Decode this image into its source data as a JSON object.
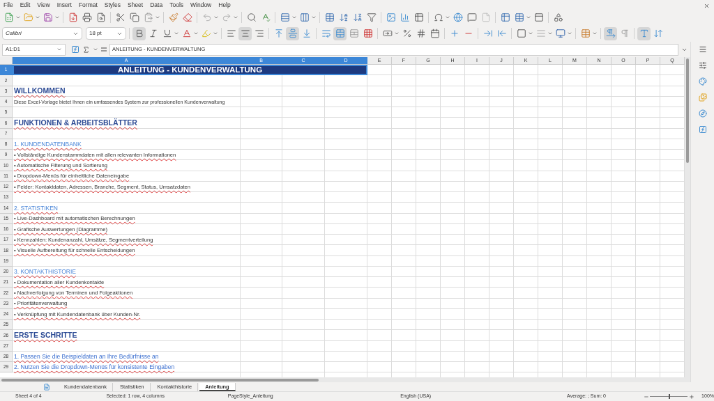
{
  "menu": [
    "File",
    "Edit",
    "View",
    "Insert",
    "Format",
    "Styles",
    "Sheet",
    "Data",
    "Tools",
    "Window",
    "Help"
  ],
  "format_toolbar": {
    "font_name": "Calibri",
    "font_size": "18 pt",
    "bold": true,
    "italic": false,
    "underline": false,
    "align_left": false,
    "align_center": true,
    "align_right": false,
    "valign_top": false,
    "valign_center": true,
    "valign_bottom": false,
    "merge_center": true,
    "ltr": true,
    "horizontal_text": true
  },
  "formula_bar": {
    "name_box": "A1:D1",
    "content": "ANLEITUNG - KUNDENVERWALTUNG"
  },
  "columns": [
    {
      "label": "A",
      "selected": true
    },
    {
      "label": "B",
      "selected": true
    },
    {
      "label": "C",
      "selected": true
    },
    {
      "label": "D",
      "selected": true
    },
    {
      "label": "E",
      "selected": false
    },
    {
      "label": "F",
      "selected": false
    },
    {
      "label": "G",
      "selected": false
    },
    {
      "label": "H",
      "selected": false
    },
    {
      "label": "I",
      "selected": false
    },
    {
      "label": "J",
      "selected": false
    },
    {
      "label": "K",
      "selected": false
    },
    {
      "label": "L",
      "selected": false
    },
    {
      "label": "M",
      "selected": false
    },
    {
      "label": "N",
      "selected": false
    },
    {
      "label": "O",
      "selected": false
    },
    {
      "label": "P",
      "selected": false
    },
    {
      "label": "Q",
      "selected": false
    }
  ],
  "rows": [
    {
      "number": "1",
      "selected": true,
      "kind": "title",
      "text": "ANLEITUNG - KUNDENVERWALTUNG"
    },
    {
      "number": "2",
      "selected": false,
      "kind": "empty"
    },
    {
      "number": "3",
      "selected": false,
      "kind": "heading",
      "text": "WILLKOMMEN"
    },
    {
      "number": "4",
      "selected": false,
      "kind": "wrapped",
      "text": "Diese Excel-Vorlage bietet Ihnen ein umfassendes System zur professionellen Kundenverwaltung"
    },
    {
      "number": "5",
      "selected": false,
      "kind": "empty"
    },
    {
      "number": "6",
      "selected": false,
      "kind": "heading",
      "text": "FUNKTIONEN & ARBEITSBLÄTTER"
    },
    {
      "number": "7",
      "selected": false,
      "kind": "empty"
    },
    {
      "number": "8",
      "selected": false,
      "kind": "subheading",
      "text": "1. KUNDENDATENBANK"
    },
    {
      "number": "9",
      "selected": false,
      "kind": "bullet",
      "text": "• Vollständige Kundenstammdaten mit allen relevanten Informationen"
    },
    {
      "number": "10",
      "selected": false,
      "kind": "bullet",
      "text": "• Automatische Filterung und Sortierung"
    },
    {
      "number": "11",
      "selected": false,
      "kind": "bullet",
      "text": "• Dropdown-Menüs für einheitliche Dateneingabe"
    },
    {
      "number": "12",
      "selected": false,
      "kind": "bullet",
      "text": "• Felder: Kontaktdaten, Adressen, Branche, Segment, Status, Umsatzdaten"
    },
    {
      "number": "13",
      "selected": false,
      "kind": "empty"
    },
    {
      "number": "14",
      "selected": false,
      "kind": "subheading",
      "text": "2. STATISTIKEN"
    },
    {
      "number": "15",
      "selected": false,
      "kind": "bullet",
      "text": "• Live-Dashboard mit automatischen Berechnungen"
    },
    {
      "number": "16",
      "selected": false,
      "kind": "bullet",
      "text": "• Grafische Auswertungen (Diagramme)"
    },
    {
      "number": "17",
      "selected": false,
      "kind": "bullet",
      "text": "• Kennzahlen: Kundenanzahl, Umsätze, Segmentverteilung"
    },
    {
      "number": "18",
      "selected": false,
      "kind": "bullet",
      "text": "• Visuelle Aufbereitung für schnelle Entscheidungen"
    },
    {
      "number": "19",
      "selected": false,
      "kind": "empty"
    },
    {
      "number": "20",
      "selected": false,
      "kind": "subheading",
      "text": "3. KONTAKTHISTORIE"
    },
    {
      "number": "21",
      "selected": false,
      "kind": "bullet",
      "text": "• Dokumentation aller Kundenkontakte"
    },
    {
      "number": "22",
      "selected": false,
      "kind": "bullet",
      "text": "• Nachverfolgung von Terminen und Folgeaktionen"
    },
    {
      "number": "23",
      "selected": false,
      "kind": "bullet",
      "text": "• Prioritätenverwaltung"
    },
    {
      "number": "24",
      "selected": false,
      "kind": "bullet",
      "text": "• Verknüpfung mit Kundendatenbank über Kunden-Nr."
    },
    {
      "number": "25",
      "selected": false,
      "kind": "empty"
    },
    {
      "number": "26",
      "selected": false,
      "kind": "heading",
      "text": "ERSTE SCHRITTE"
    },
    {
      "number": "27",
      "selected": false,
      "kind": "empty"
    },
    {
      "number": "28",
      "selected": false,
      "kind": "step",
      "text": "1. Passen Sie die Beispieldaten an Ihre Bedürfnisse an"
    },
    {
      "number": "29",
      "selected": false,
      "kind": "step",
      "text": "2. Nutzen Sie die Dropdown-Menüs für konsistente Eingaben"
    }
  ],
  "sheet_tabs": [
    {
      "label": "Kundendatenbank",
      "selected": false
    },
    {
      "label": "Statistiken",
      "selected": false
    },
    {
      "label": "Kontakthistorie",
      "selected": false
    },
    {
      "label": "Anleitung",
      "selected": true
    }
  ],
  "status_bar": {
    "sheet": "Sheet 4 of 4",
    "selection": "Selected: 1 row, 4 columns",
    "page_style": "PageStyle_Anleitung",
    "language": "English (USA)",
    "sum": "Average: ; Sum: 0",
    "zoom_slider": {
      "level": 0.5
    },
    "zoom": "100%"
  }
}
